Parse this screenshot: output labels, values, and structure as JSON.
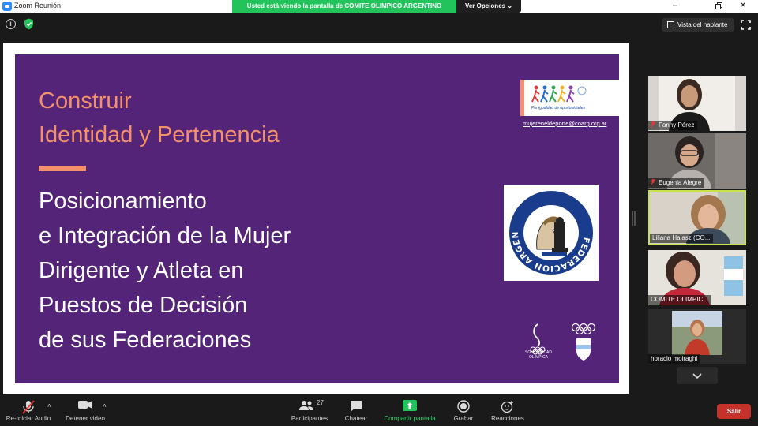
{
  "window": {
    "title": "Zoom Reunión"
  },
  "share_banner": {
    "text": "Usted está viendo la pantalla de  COMITE OLIMPICO ARGENTINO",
    "view_options_label": "Ver Opciones"
  },
  "top_bar": {
    "speaker_view_label": "Vista del hablante"
  },
  "slide": {
    "heading": "Construir\nIdentidad y Pertenencia",
    "body": "Posicionamiento\ne Integración de la Mujer\nDirigente y Atleta en\nPuestos de Decisión\nde sus Federaciones",
    "email": "mujereneldeporte@coarg.org.ar",
    "logo_tagline": "Por igualdad de oportunidades",
    "federation_seal_text": "FEDERACION ARGENTINA DE AJEDREZ",
    "solidaridad_text": "SOLIDARIDAD\nOLÍMPICA",
    "coa_text": "COMITÉ OLÍMPICO ARGENTINO"
  },
  "participants": [
    {
      "name": "Fanny Pérez",
      "muted": true
    },
    {
      "name": "Eugenia Alegre",
      "muted": true
    },
    {
      "name": "Liliana Halasz (CO...",
      "muted": false,
      "active_speaker": true
    },
    {
      "name": "COMITE OLIMPIC...",
      "muted": false
    },
    {
      "name": "horacio moiraghi",
      "muted": false
    }
  ],
  "toolbar": {
    "audio_label": "Re-Iniciar Audio",
    "video_label": "Detener video",
    "participants_label": "Participantes",
    "participants_count": "27",
    "chat_label": "Chatear",
    "share_label": "Compartir pantalla",
    "record_label": "Grabar",
    "reactions_label": "Reacciones",
    "leave_label": "Salir"
  },
  "colors": {
    "slide_purple": "#532478",
    "slide_accent": "#f4916a",
    "share_green": "#22c35b",
    "active_border": "#c8e24a",
    "leave_red": "#c4322b"
  }
}
